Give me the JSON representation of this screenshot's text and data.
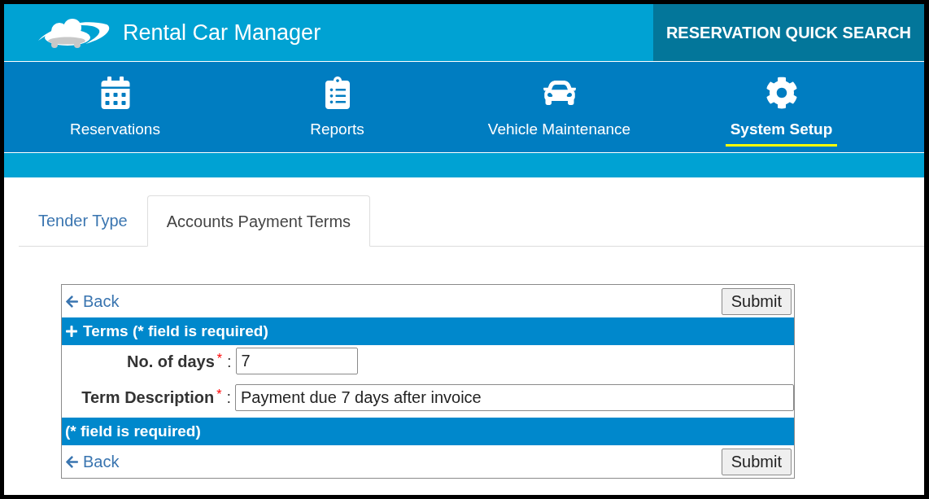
{
  "header": {
    "title": "Rental Car Manager",
    "quick_search": "RESERVATION QUICK SEARCH"
  },
  "nav": [
    {
      "label": "Reservations",
      "selected": false
    },
    {
      "label": "Reports",
      "selected": false
    },
    {
      "label": "Vehicle Maintenance",
      "selected": false
    },
    {
      "label": "System Setup",
      "selected": true
    }
  ],
  "tabs": [
    {
      "label": "Tender Type",
      "selected": false
    },
    {
      "label": "Accounts Payment Terms",
      "selected": true
    }
  ],
  "form": {
    "top_bar": {
      "back": "Back",
      "submit": "Submit"
    },
    "section_title": "Terms (* field is required)",
    "fields": [
      {
        "label": "No. of days",
        "required_mark": "*",
        "separator": ":",
        "value": "7",
        "kind": "short"
      },
      {
        "label": "Term Description",
        "required_mark": "*",
        "separator": ":",
        "value": "Payment due 7 days after invoice",
        "kind": "long"
      }
    ],
    "footer_note": "(* field is required)",
    "bottom_bar": {
      "back": "Back",
      "submit": "Submit"
    }
  }
}
